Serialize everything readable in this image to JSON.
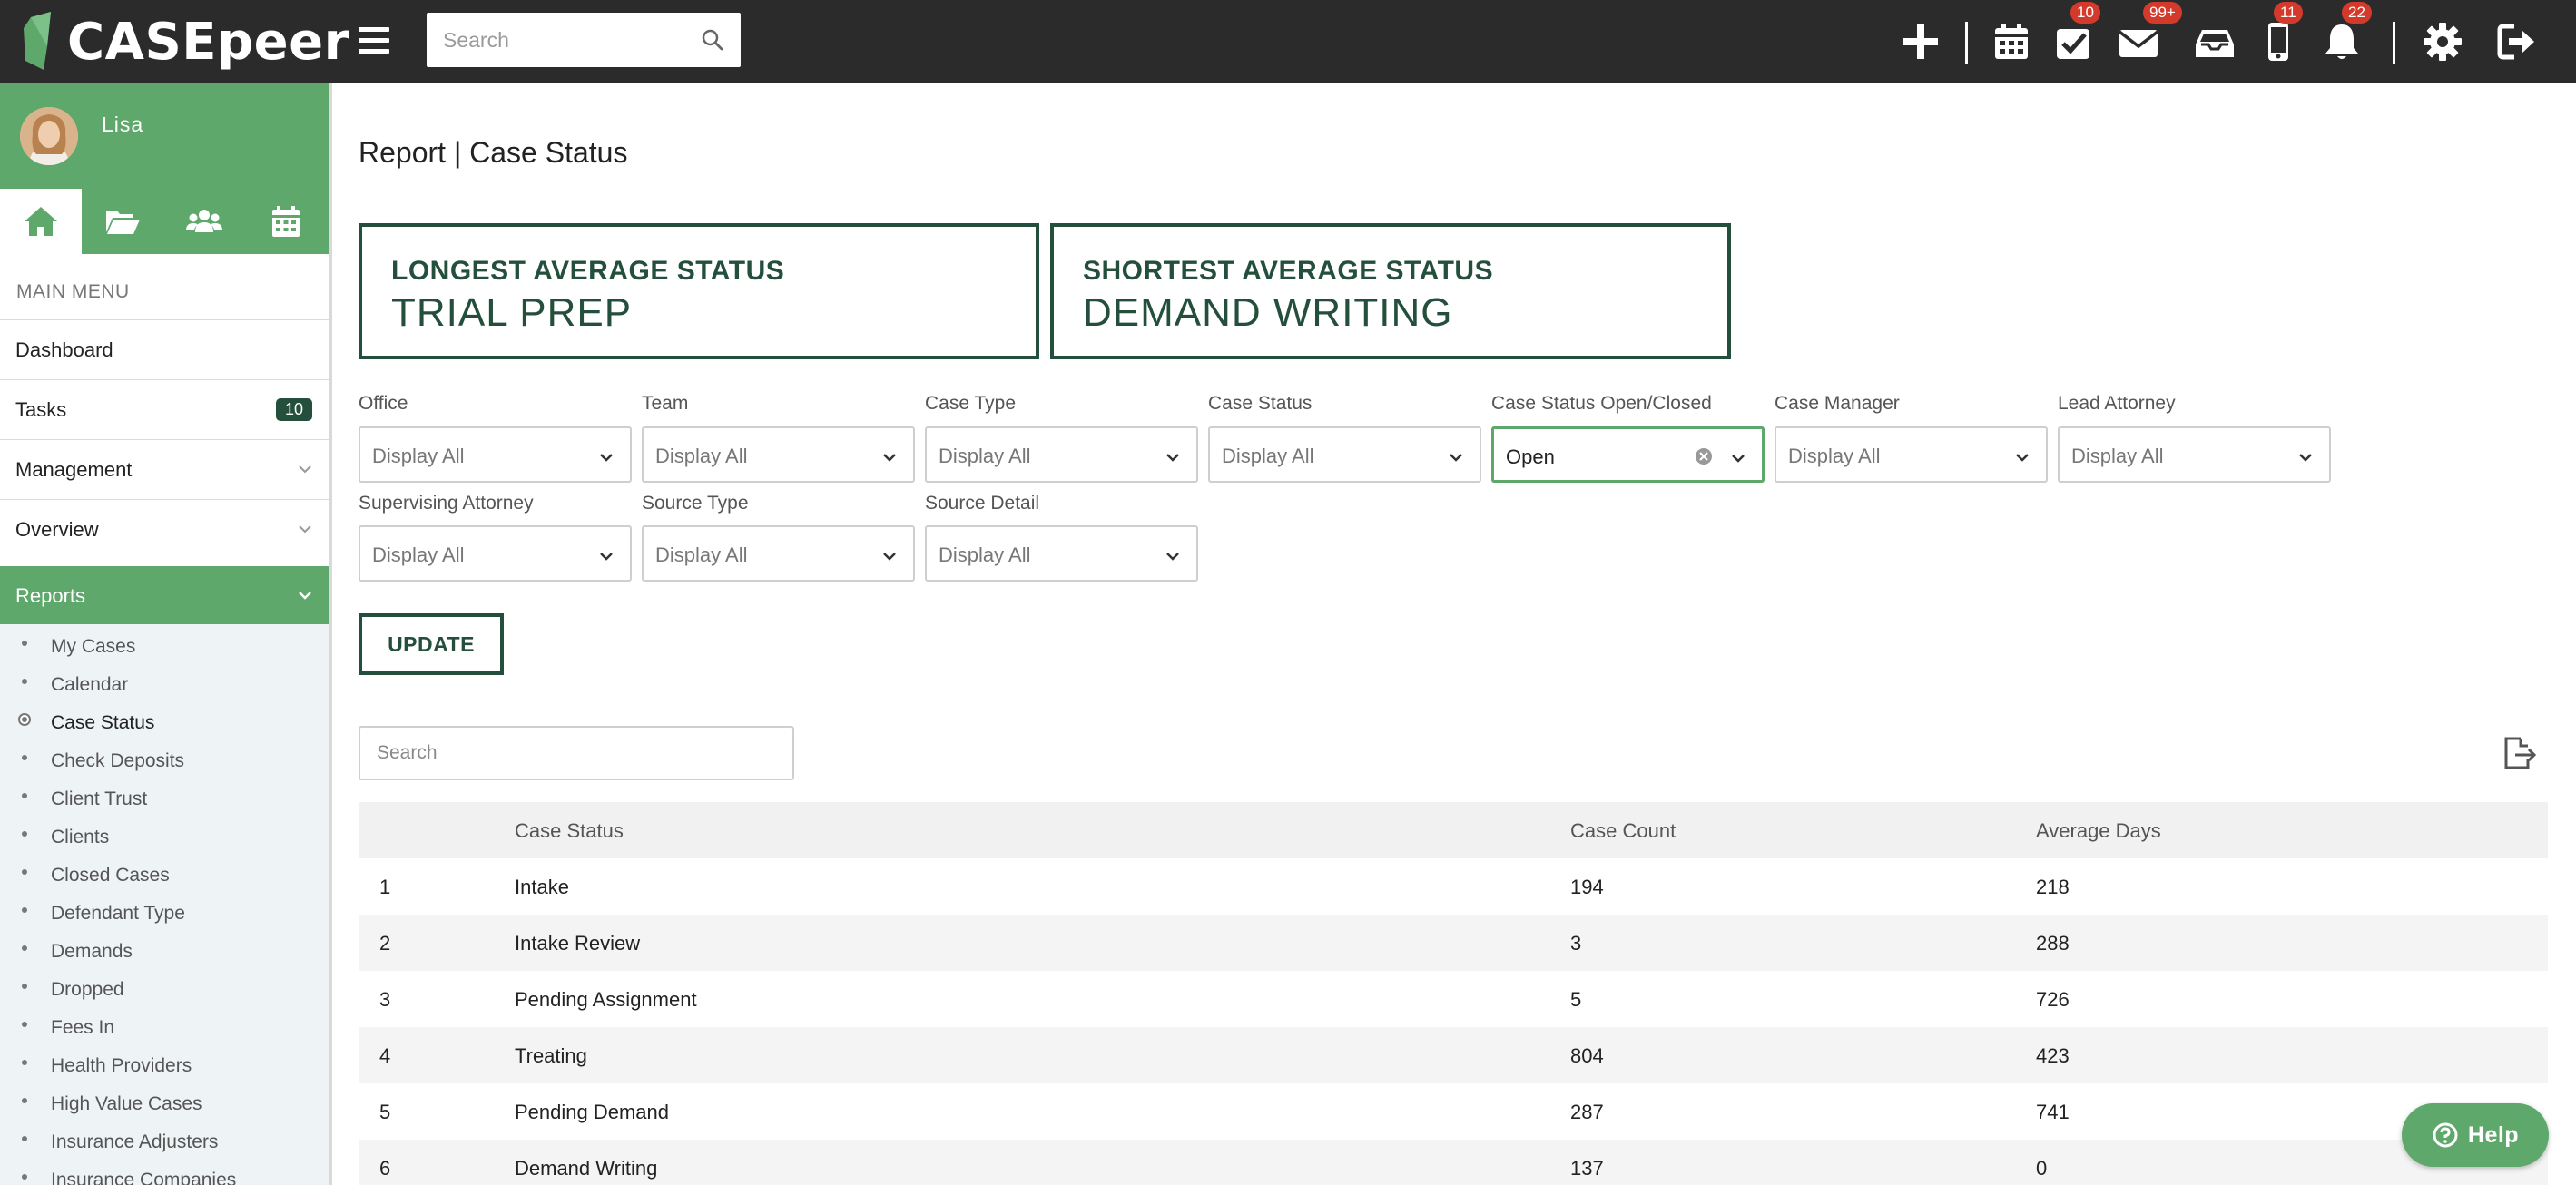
{
  "app": {
    "logo_text": "CASEpeer",
    "search_placeholder": "Search"
  },
  "topbar": {
    "icons": [
      {
        "name": "plus-icon"
      },
      {
        "name": "calendar-icon"
      },
      {
        "name": "tasks-check-icon",
        "badge": "10"
      },
      {
        "name": "mail-icon",
        "badge": "99+"
      },
      {
        "name": "inbox-icon"
      },
      {
        "name": "phone-icon",
        "badge": "11"
      },
      {
        "name": "bell-icon",
        "badge": "22"
      },
      {
        "name": "gear-icon"
      },
      {
        "name": "logout-icon"
      }
    ],
    "badge_color": "#d33a2c"
  },
  "sidebar": {
    "user_name": "Lisa",
    "tabs": [
      {
        "name": "home-icon",
        "active": true
      },
      {
        "name": "folder-open-icon",
        "active": false
      },
      {
        "name": "users-icon",
        "active": false
      },
      {
        "name": "calendar-icon",
        "active": false
      }
    ],
    "menu_heading": "MAIN MENU",
    "menu_items": [
      {
        "label": "Dashboard"
      },
      {
        "label": "Tasks",
        "badge": "10"
      },
      {
        "label": "Management"
      },
      {
        "label": "Overview"
      },
      {
        "label": "Reports",
        "active": true
      }
    ],
    "report_items": [
      {
        "label": "My Cases"
      },
      {
        "label": "Calendar"
      },
      {
        "label": "Case Status",
        "active": true
      },
      {
        "label": "Check Deposits"
      },
      {
        "label": "Client Trust"
      },
      {
        "label": "Clients"
      },
      {
        "label": "Closed Cases"
      },
      {
        "label": "Defendant Type"
      },
      {
        "label": "Demands"
      },
      {
        "label": "Dropped"
      },
      {
        "label": "Fees In"
      },
      {
        "label": "Health Providers"
      },
      {
        "label": "High Value Cases"
      },
      {
        "label": "Insurance Adjusters"
      },
      {
        "label": "Insurance Companies"
      }
    ],
    "accent_color": "#5fa86b"
  },
  "main": {
    "page_title": "Report | Case Status",
    "stats": {
      "longest": {
        "label": "LONGEST AVERAGE STATUS",
        "value": "TRIAL PREP"
      },
      "shortest": {
        "label": "SHORTEST AVERAGE STATUS",
        "value": "DEMAND WRITING"
      }
    },
    "filters": {
      "office": {
        "label": "Office",
        "value": "Display All"
      },
      "team": {
        "label": "Team",
        "value": "Display All"
      },
      "case_type": {
        "label": "Case Type",
        "value": "Display All"
      },
      "case_status": {
        "label": "Case Status",
        "value": "Display All"
      },
      "open_closed": {
        "label": "Case Status Open/Closed",
        "value": "Open"
      },
      "case_manager": {
        "label": "Case Manager",
        "value": "Display All"
      },
      "lead_attorney": {
        "label": "Lead Attorney",
        "value": "Display All"
      },
      "supervising_attorney": {
        "label": "Supervising Attorney",
        "value": "Display All"
      },
      "source_type": {
        "label": "Source Type",
        "value": "Display All"
      },
      "source_detail": {
        "label": "Source Detail",
        "value": "Display All"
      }
    },
    "update_label": "UPDATE",
    "table_search_placeholder": "Search",
    "table": {
      "headers": {
        "status": "Case Status",
        "count": "Case Count",
        "days": "Average Days"
      },
      "rows": [
        {
          "index": "1",
          "status": "Intake",
          "count": "194",
          "days": "218"
        },
        {
          "index": "2",
          "status": "Intake Review",
          "count": "3",
          "days": "288"
        },
        {
          "index": "3",
          "status": "Pending Assignment",
          "count": "5",
          "days": "726"
        },
        {
          "index": "4",
          "status": "Treating",
          "count": "804",
          "days": "423"
        },
        {
          "index": "5",
          "status": "Pending Demand",
          "count": "287",
          "days": "741"
        },
        {
          "index": "6",
          "status": "Demand Writing",
          "count": "137",
          "days": "0"
        }
      ]
    },
    "help_label": "Help",
    "brand_dark": "#244f3c"
  }
}
